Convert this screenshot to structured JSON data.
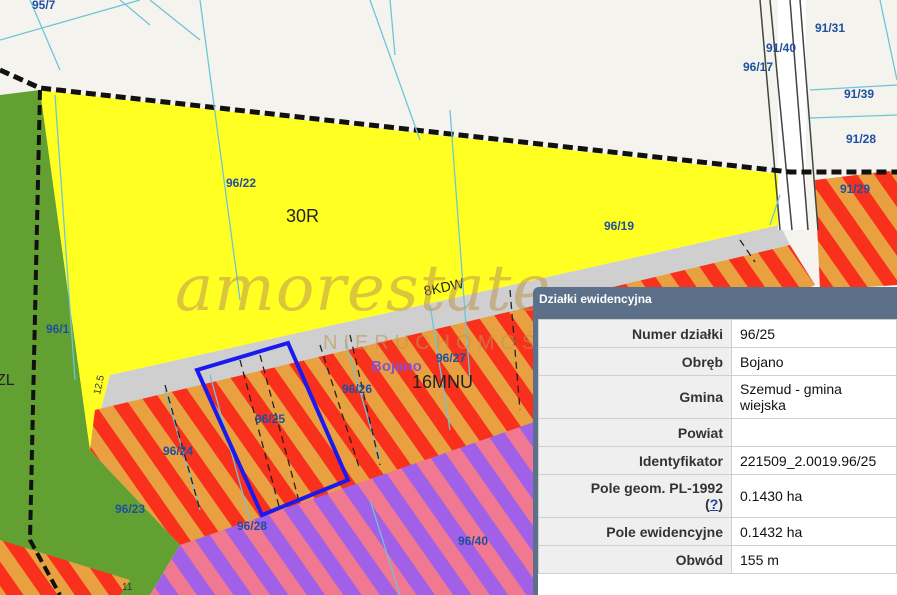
{
  "map": {
    "parcel_labels": [
      "95/7",
      "91/31",
      "91/40",
      "96/17",
      "91/39",
      "91/28",
      "91/29",
      "96/22",
      "96/19",
      "96/1",
      "96/27",
      "96/26",
      "96/25",
      "96/24",
      "96/23",
      "96/28",
      "96/40",
      "12.5",
      "11"
    ],
    "zone_labels": [
      "30R",
      "16MNU",
      "ZL",
      "8KDW"
    ],
    "place_name": "Bojano",
    "colors": {
      "agricultural": "#ffff22",
      "forest": "#63a032",
      "road": "#cfcfcf",
      "residential_stripe_red": "#f8301c",
      "residential_stripe_orange": "#e8a040",
      "services_stripe_purple": "#a060e8",
      "services_stripe_pink": "#f07890",
      "parcel_line": "#6fc4d8",
      "selected_parcel": "#1a1aee",
      "place_name": "#8a4fd0"
    }
  },
  "watermark": {
    "script": "amorestate",
    "sub": "NIERUCHOMOŚCI"
  },
  "panel": {
    "title": "Działki ewidencyjna",
    "rows": [
      {
        "key": "Numer działki",
        "value": "96/25"
      },
      {
        "key": "Obręb",
        "value": "Bojano"
      },
      {
        "key": "Gmina",
        "value": "Szemud - gmina wiejska"
      },
      {
        "key": "Powiat",
        "value": ""
      },
      {
        "key": "Identyfikator",
        "value": "221509_2.0019.96/25"
      },
      {
        "key": "Pole geom. PL-1992",
        "help": "?",
        "value": "0.1430 ha"
      },
      {
        "key": "Pole ewidencyjne",
        "value": "0.1432 ha"
      },
      {
        "key": "Obwód",
        "value": "155 m"
      }
    ]
  }
}
